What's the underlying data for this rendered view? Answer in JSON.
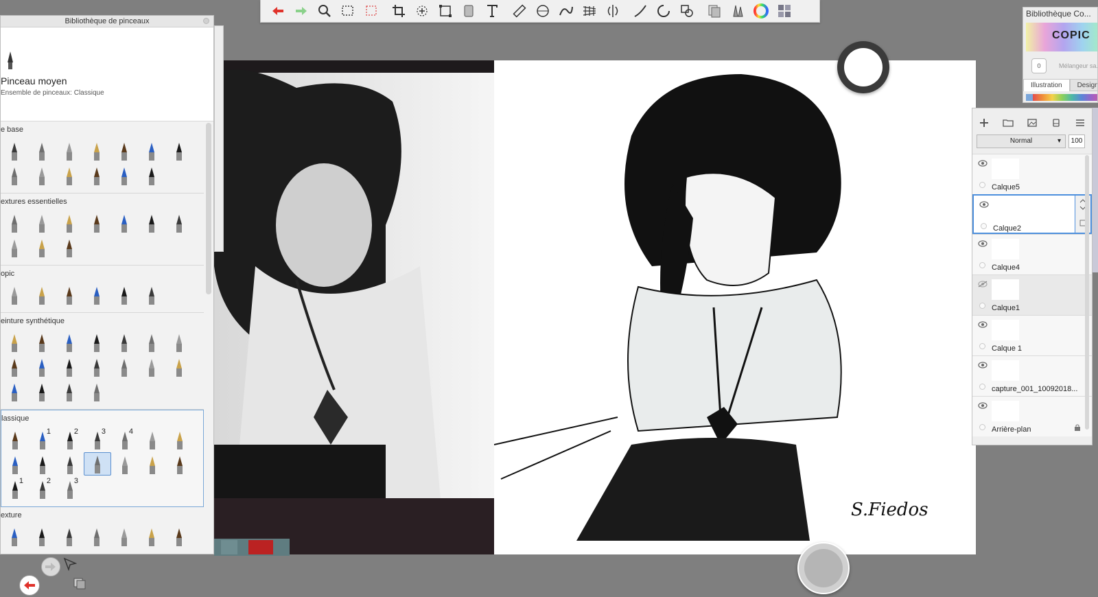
{
  "toolbar": {
    "tools": [
      "undo-icon",
      "redo-icon",
      "zoom-icon",
      "rect-select-icon",
      "lasso-select-icon",
      "crop-icon",
      "transform-icon",
      "distort-icon",
      "fill-icon",
      "text-icon",
      "ruler-icon",
      "ellipse-guide-icon",
      "french-curve-icon",
      "perspective-icon",
      "symmetry-icon",
      "stroke-icon",
      "shape-icon",
      "color-puck-icon",
      "layer-editor-icon",
      "brush-library-icon",
      "color-wheel-icon",
      "copic-library-icon"
    ]
  },
  "brush_library": {
    "title": "Bibliothèque de pinceaux",
    "brush_name": "Pinceau moyen",
    "brush_set": "Ensemble de pinceaux: Classique",
    "sections": [
      {
        "label": "e base",
        "rows": [
          7,
          6
        ],
        "numbers": []
      },
      {
        "label": "extures essentielles",
        "rows": [
          7,
          3
        ],
        "numbers": []
      },
      {
        "label": "opic",
        "rows": [
          6
        ],
        "numbers": []
      },
      {
        "label": "einture synthétique",
        "rows": [
          7,
          7,
          4
        ],
        "numbers": []
      },
      {
        "label": "lassique",
        "rows": [
          7,
          7,
          3
        ],
        "numbers": [
          "",
          "1",
          "2",
          "3",
          "4",
          "",
          "",
          "",
          "",
          "",
          "",
          "",
          "",
          "",
          "1",
          "2",
          "3"
        ],
        "selected": true
      },
      {
        "label": "exture",
        "rows": [
          7
        ],
        "numbers": []
      }
    ]
  },
  "color_library": {
    "title": "Bibliothèque Co...",
    "brand": "COPIC",
    "mixer_value": "0",
    "mixer_label": "Mélangeur sa...",
    "tabs": [
      "Illustration",
      "Design"
    ]
  },
  "layers": {
    "blend_mode": "Normal",
    "opacity": "100",
    "items": [
      {
        "name": "Calque5",
        "visible": true
      },
      {
        "name": "Calque2",
        "visible": true,
        "selected": true
      },
      {
        "name": "Calque4",
        "visible": true
      },
      {
        "name": "Calque1",
        "visible": false
      },
      {
        "name": "Calque 1",
        "visible": true
      },
      {
        "name": "capture_001_10092018...",
        "visible": true
      },
      {
        "name": "Arrière-plan",
        "visible": true,
        "locked": true
      }
    ]
  },
  "canvas": {
    "signature": "S.Fiedos"
  },
  "colors": {
    "accent": "#4c8fdd",
    "panel": "#eeeeee",
    "background": "#7f7f7f"
  }
}
